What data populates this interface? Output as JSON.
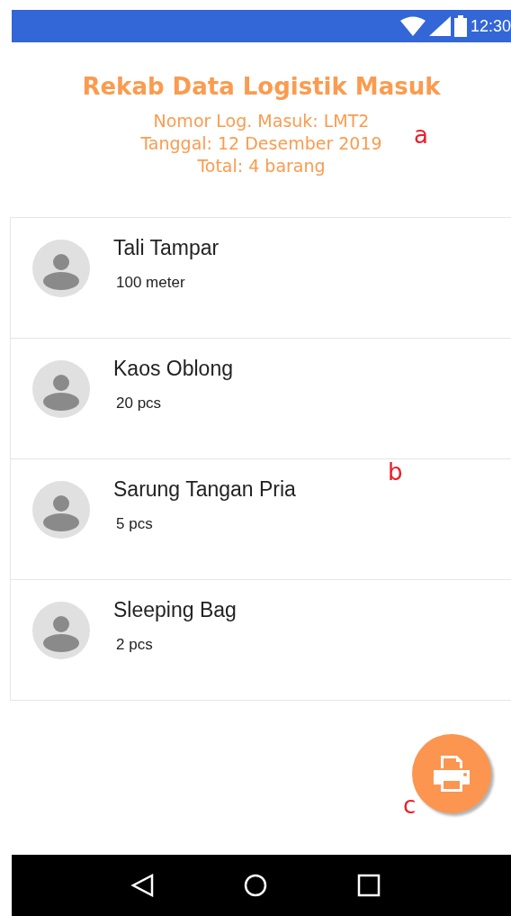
{
  "status_bar": {
    "time": "12:30"
  },
  "header": {
    "title": "Rekab Data Logistik Masuk",
    "lines": [
      "Nomor Log. Masuk: LMT2",
      "Tanggal: 12 Desember 2019",
      "Total: 4 barang"
    ]
  },
  "items": [
    {
      "name": "Tali Tampar",
      "quantity": "100 meter"
    },
    {
      "name": "Kaos Oblong",
      "quantity": "20 pcs"
    },
    {
      "name": "Sarung Tangan Pria",
      "quantity": "5 pcs"
    },
    {
      "name": "Sleeping Bag",
      "quantity": "2 pcs"
    }
  ],
  "annotations": [
    "a",
    "b",
    "c"
  ]
}
